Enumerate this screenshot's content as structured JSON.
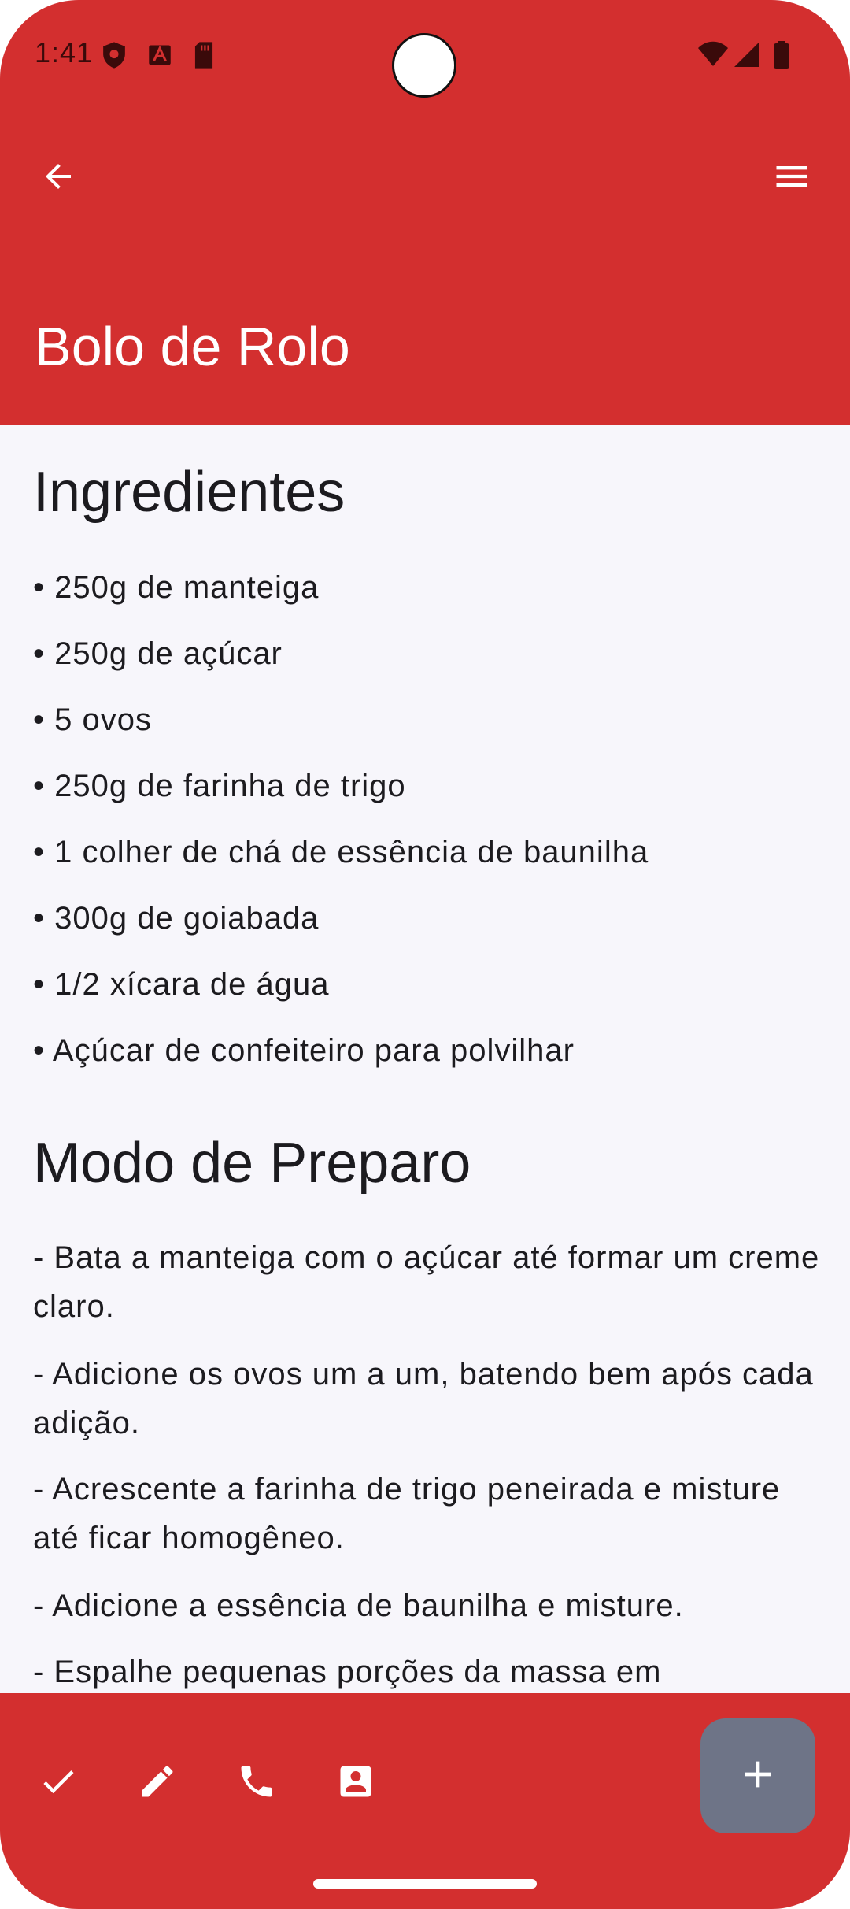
{
  "status_bar": {
    "time": "1:41",
    "icons": [
      "shield-icon",
      "font-a-icon",
      "sd-card-icon",
      "wifi-icon",
      "signal-icon",
      "battery-icon"
    ]
  },
  "toolbar": {
    "back_icon": "arrow-left-icon",
    "menu_icon": "menu-icon"
  },
  "page": {
    "title": "Bolo de Rolo"
  },
  "ingredients": {
    "title": "Ingredientes",
    "items": [
      "• 250g de manteiga",
      "• 250g de açúcar",
      "• 5 ovos",
      "• 250g de farinha de trigo",
      "• 1 colher de chá de essência de baunilha",
      "• 300g de goiabada",
      "• 1/2 xícara de água",
      "• Açúcar de confeiteiro para polvilhar"
    ]
  },
  "preparation": {
    "title": "Modo de Preparo",
    "steps": [
      "- Bata a manteiga com o açúcar até formar um creme claro.",
      "- Adicione os ovos um a um, batendo bem após cada adição.",
      "- Acrescente a farinha de trigo peneirada e misture até ficar homogêneo.",
      "- Adicione a essência de baunilha e misture.",
      "- Espalhe pequenas porções da massa em"
    ]
  },
  "bottom_bar": {
    "actions": [
      "check-icon",
      "edit-icon",
      "phone-icon",
      "contact-icon"
    ],
    "fab_icon": "add-icon"
  },
  "colors": {
    "primary": "#d32f2f",
    "fab": "#6e7487",
    "background": "#f7f6fb",
    "text": "#1c1b1f"
  }
}
